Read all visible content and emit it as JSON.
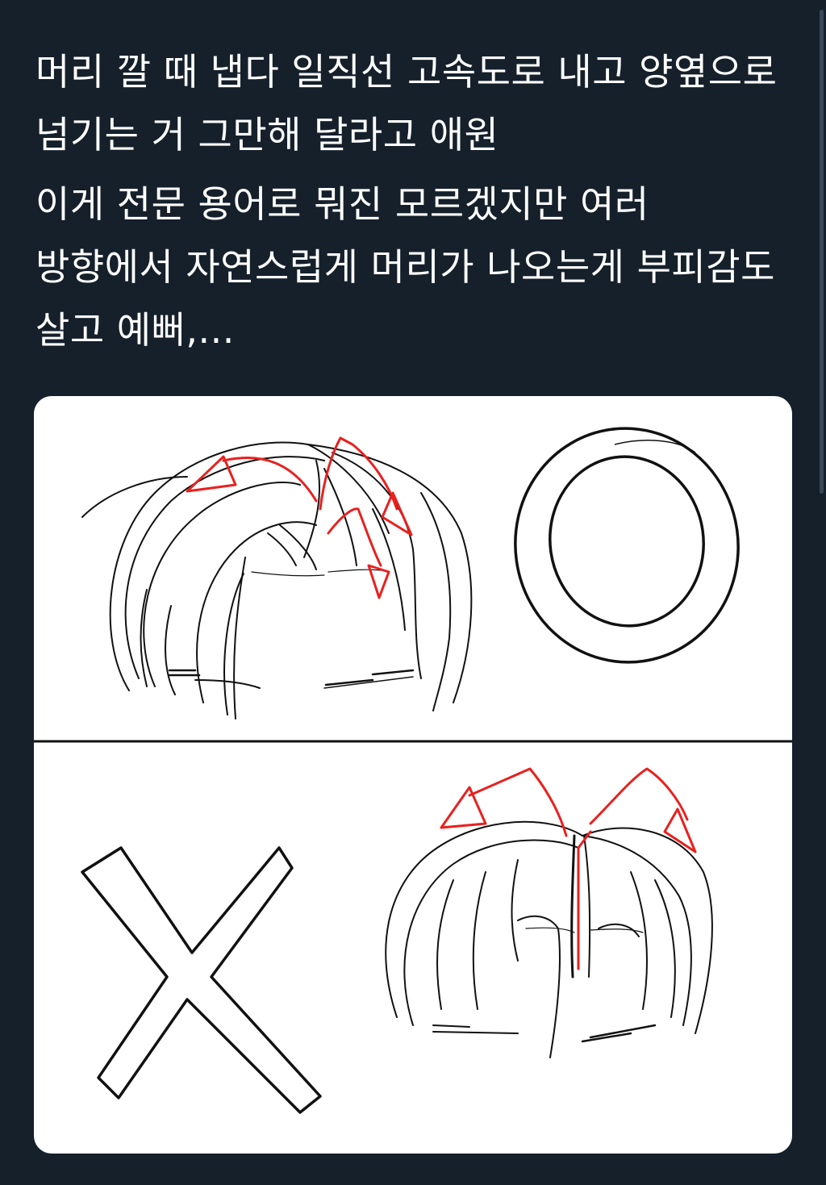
{
  "tweet": {
    "paragraph_1": "머리 깔 때 냅다 일직선 고속도로 내고 양옆으로 넘기는 거 그만해 달라고 애원",
    "paragraph_2": "이게 전문 용어로 뭐진 모르겠지만 여러 방향에서 자연스럽게 머리가 나오는게 부피감도 살고 예뻐,..."
  },
  "media": {
    "panels": [
      {
        "verdict": "O",
        "description": "good-hair-parting"
      },
      {
        "verdict": "X",
        "description": "bad-hair-parting"
      }
    ],
    "colors": {
      "background": "#ffffff",
      "lineart": "#111111",
      "arrow": "#e8211f"
    }
  },
  "theme": {
    "background": "#15202b",
    "text": "#ffffff"
  }
}
